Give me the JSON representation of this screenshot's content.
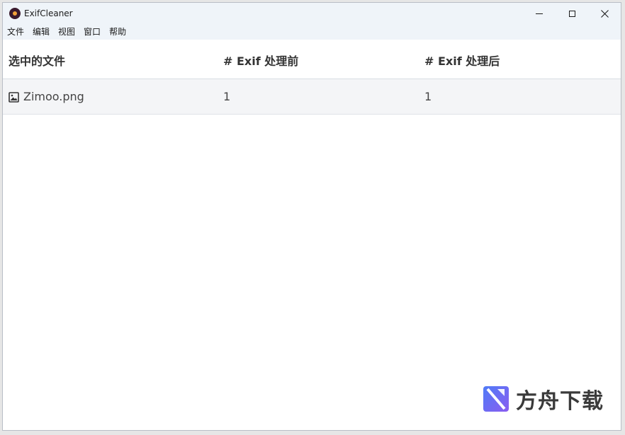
{
  "window": {
    "title": "ExifCleaner"
  },
  "menu": [
    "文件",
    "编辑",
    "视图",
    "窗口",
    "帮助"
  ],
  "table": {
    "headers": [
      "选中的文件",
      "# Exif 处理前",
      "# Exif 处理后"
    ],
    "rows": [
      {
        "file": "Zimoo.png",
        "icon": "image-icon",
        "before": "1",
        "after": "1"
      }
    ]
  },
  "watermark": {
    "text": "方舟下载",
    "icon": "fangzhou-logo-icon"
  },
  "colors": {
    "titlebar": "#eff4f9",
    "row_bg": "#f4f5f7",
    "border": "#d8dde3"
  }
}
